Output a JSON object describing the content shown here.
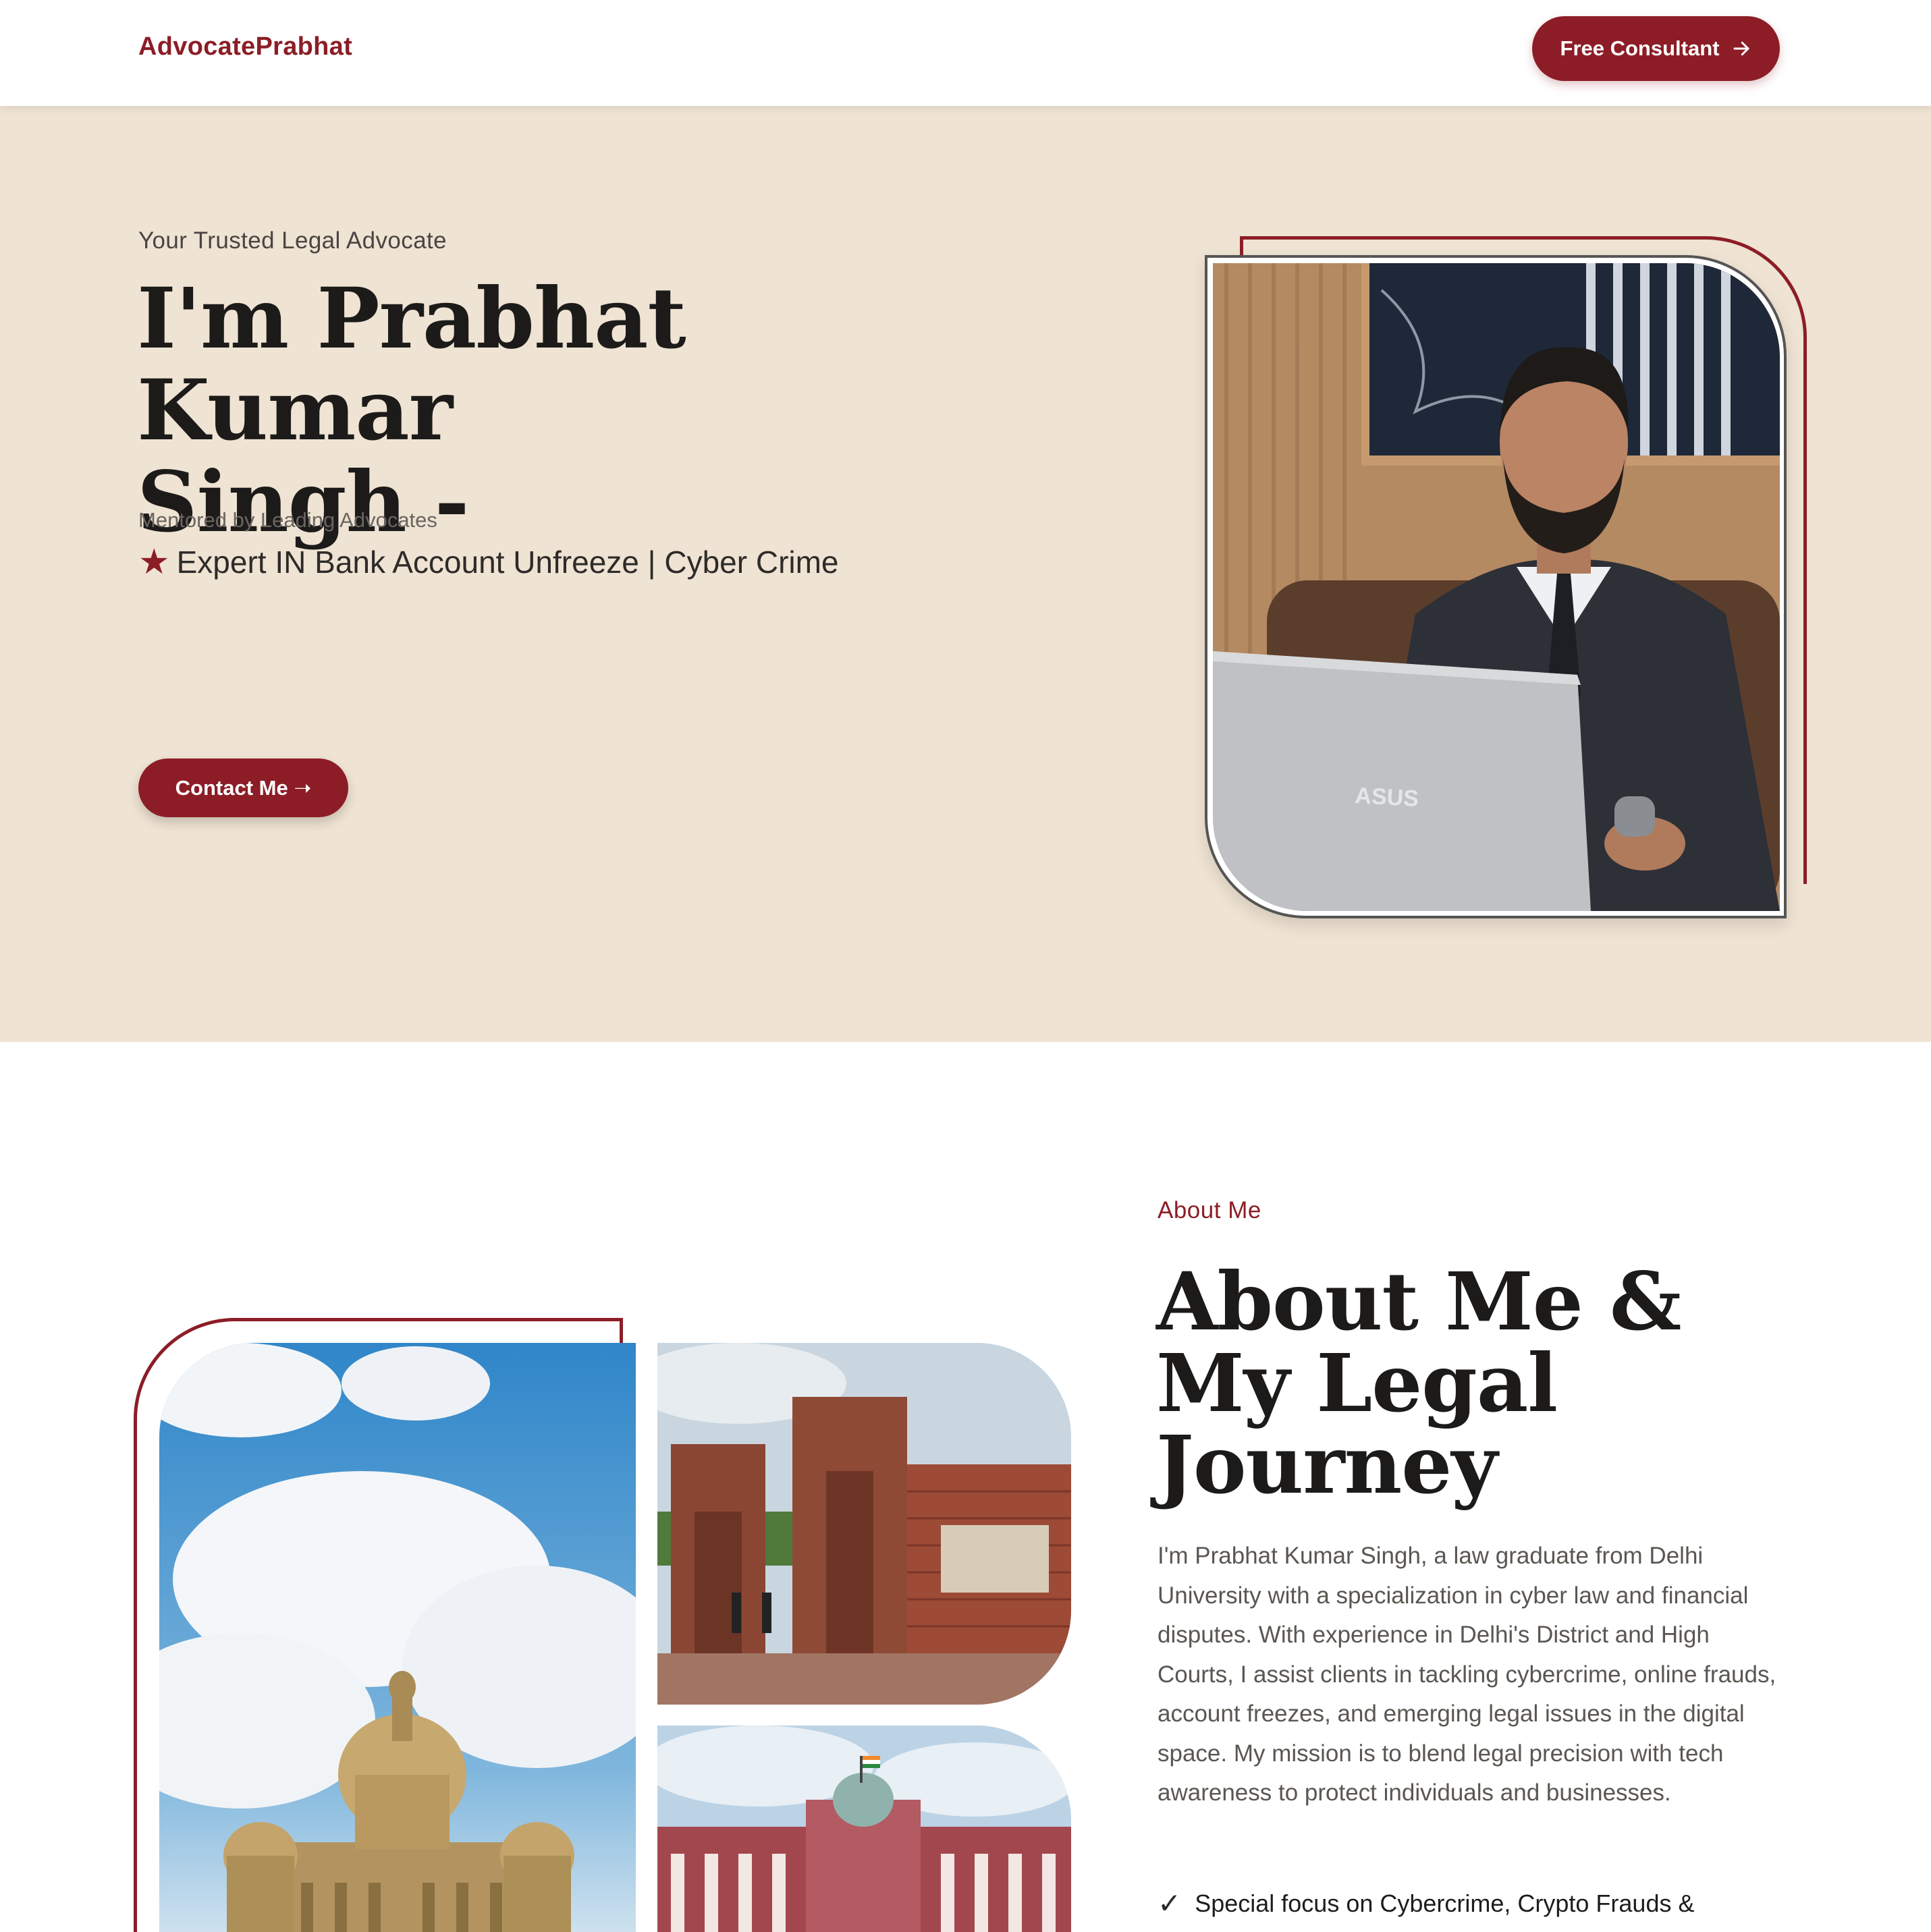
{
  "header": {
    "logo": "AdvocatePrabhat",
    "cta_label": "Free Consultant"
  },
  "hero": {
    "eyebrow": "Your Trusted Legal Advocate",
    "title_line1": "I'm Prabhat Kumar",
    "title_line2": "Singh -",
    "mentored": "Mentored by Leading Advocates",
    "expert": "Expert IN Bank Account Unfreeze | Cyber Crime",
    "contact_label": "Contact Me ➝"
  },
  "about": {
    "eyebrow": "About Me",
    "title_line1": "About Me &",
    "title_line2": "My Legal",
    "title_line3": "Journey",
    "body": "I'm Prabhat Kumar Singh, a law graduate from Delhi University with a specialization in cyber law and financial disputes. With experience in Delhi's District and High Courts, I assist clients in tackling cybercrime, online frauds, account freezes, and emerging legal issues in the digital space. My mission is to blend legal precision with tech awareness to protect individuals and businesses.",
    "check_item": "Special focus on Cybercrime, Crypto Frauds &"
  },
  "colors": {
    "brand": "#8c1d26",
    "hero_bg": "#efe3d3"
  }
}
